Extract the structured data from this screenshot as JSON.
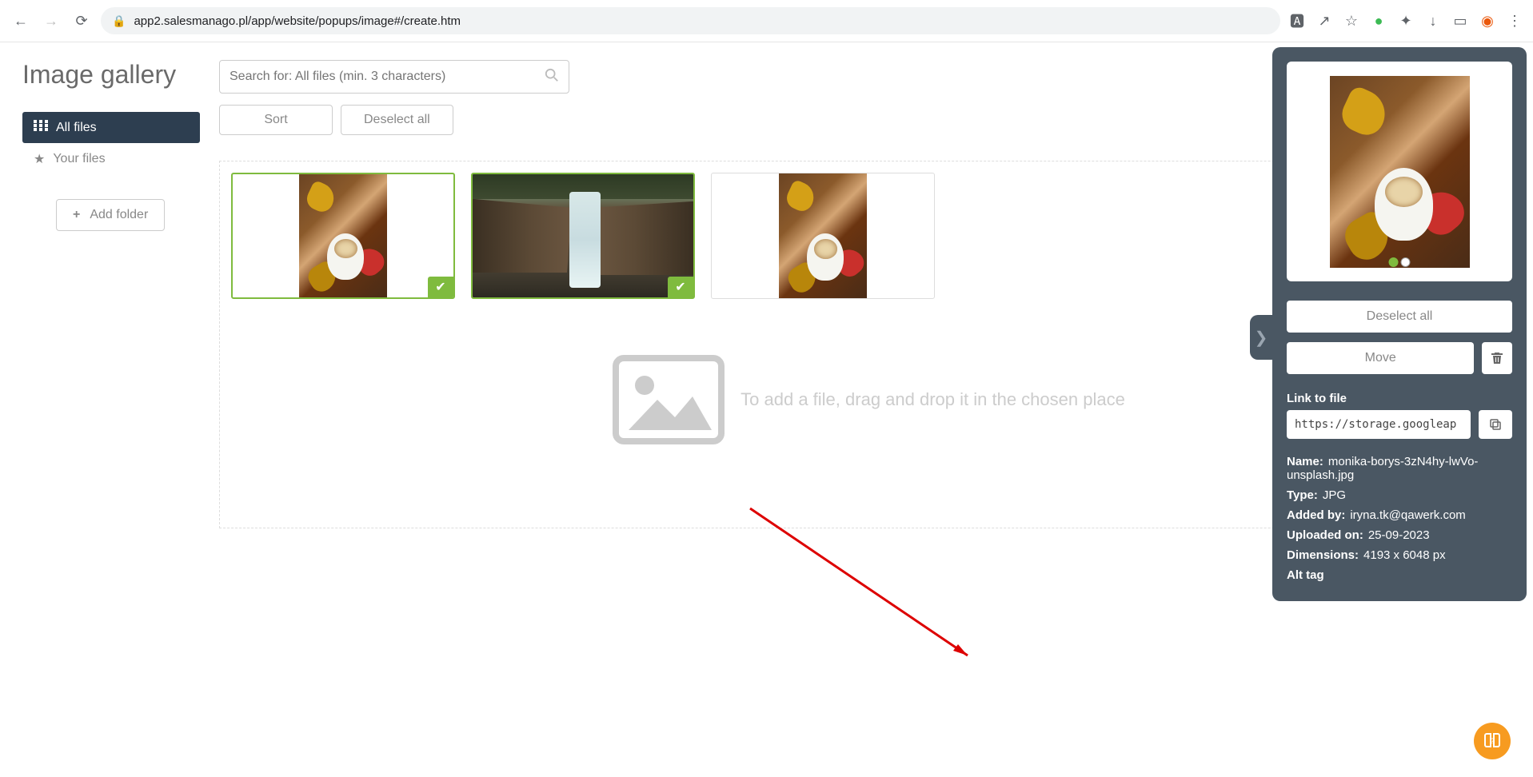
{
  "browser": {
    "url": "app2.salesmanago.pl/app/website/popups/image#/create.htm"
  },
  "page": {
    "title": "Image gallery"
  },
  "search": {
    "placeholder": "Search for: All files (min. 3 characters)"
  },
  "nav": {
    "all_files": "All files",
    "your_files": "Your files",
    "add_folder": "Add folder"
  },
  "actions": {
    "sort": "Sort",
    "deselect_all": "Deselect all"
  },
  "dropzone": {
    "text": "To add a file, drag and drop it in the chosen place"
  },
  "panel": {
    "deselect_all": "Deselect all",
    "move": "Move",
    "link_label": "Link to file",
    "link_value": "https://storage.googleap",
    "name_label": "Name:",
    "name_value": "monika-borys-3zN4hy-lwVo-unsplash.jpg",
    "type_label": "Type:",
    "type_value": "JPG",
    "added_by_label": "Added by:",
    "added_by_value": "iryna.tk@qawerk.com",
    "uploaded_on_label": "Uploaded on:",
    "uploaded_on_value": "25-09-2023",
    "dimensions_label": "Dimensions:",
    "dimensions_value": "4193 x 6048 px",
    "alt_tag_label": "Alt tag"
  }
}
